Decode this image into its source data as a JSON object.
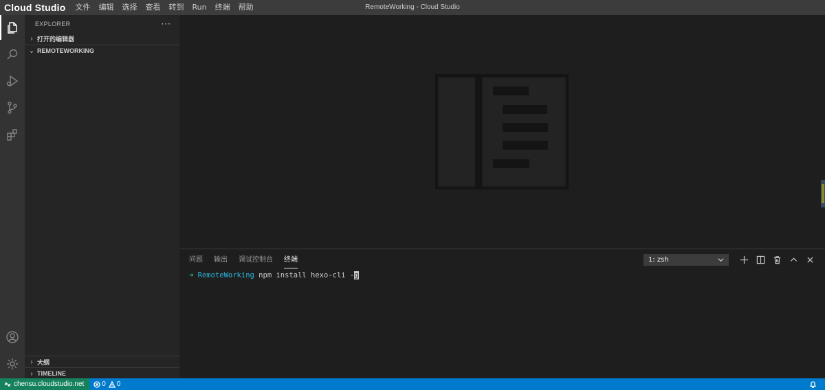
{
  "titlebar": {
    "brand": "Cloud Studio",
    "menu": [
      "文件",
      "编辑",
      "选择",
      "查看",
      "转到",
      "Run",
      "终端",
      "帮助"
    ],
    "window_title": "RemoteWorking - Cloud Studio"
  },
  "activitybar": {
    "top_icons": [
      "files-icon",
      "search-icon",
      "run-debug-icon",
      "source-control-icon",
      "extensions-icon"
    ],
    "bottom_icons": [
      "account-icon",
      "settings-gear-icon"
    ]
  },
  "sidebar": {
    "title": "EXPLORER",
    "more": "···",
    "sections": {
      "open_editors": "打开的编辑器",
      "workspace": "REMOTEWORKING",
      "outline": "大纲",
      "timeline": "TIMELINE"
    }
  },
  "panel": {
    "tabs": [
      "问题",
      "输出",
      "调试控制台",
      "终端"
    ],
    "active_tab": "终端",
    "terminal_select": "1: zsh",
    "terminal": {
      "prompt_arrow": "➜",
      "cwd": "RemoteWorking",
      "command": "npm install hexo-cli -",
      "cursor_char": "g"
    }
  },
  "statusbar": {
    "remote_host": "chensu.cloudstudio.net",
    "errors": "0",
    "warnings": "0"
  },
  "colors": {
    "titlebar": "#3c3c3c",
    "activitybar": "#333333",
    "sidebar": "#252526",
    "editor": "#1e1e1e",
    "statusbar": "#007acc",
    "remote": "#16825d",
    "terminal_arrow": "#23d18b",
    "terminal_dir": "#29b8db"
  }
}
